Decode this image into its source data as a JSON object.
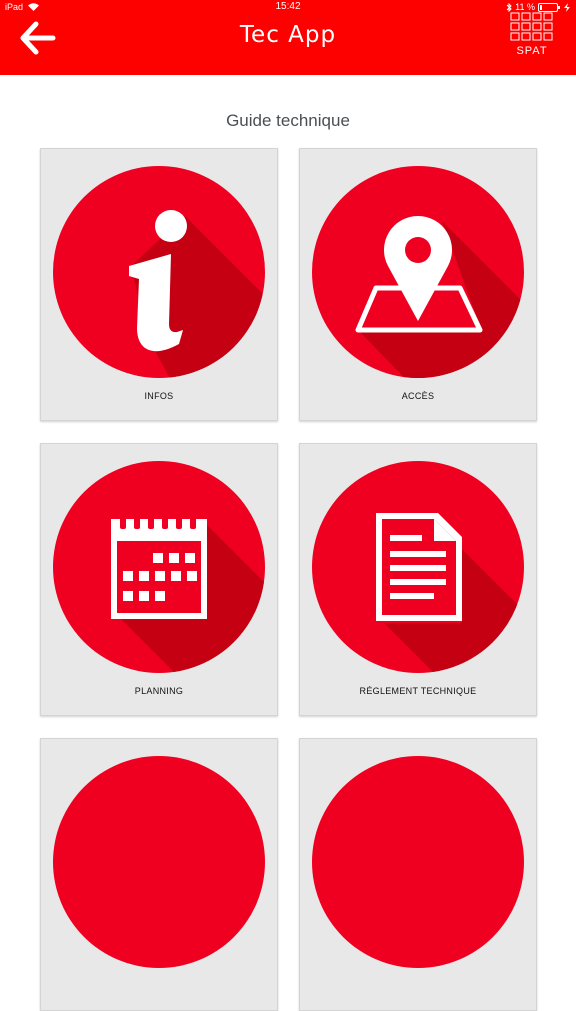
{
  "status_bar": {
    "carrier": "iPad",
    "time": "15:42",
    "battery": "11 %"
  },
  "header": {
    "title": "Tec App",
    "logo_text": "SPAT"
  },
  "section": {
    "title": "Guide technique"
  },
  "tiles": [
    {
      "label": "INFOS",
      "icon": "info-icon"
    },
    {
      "label": "ACCÈS",
      "icon": "map-pin-icon"
    },
    {
      "label": "PLANNING",
      "icon": "calendar-icon"
    },
    {
      "label": "RÉGLEMENT TECHNIQUE",
      "icon": "document-icon"
    }
  ],
  "colors": {
    "brand_red": "#fd0000",
    "circle_red": "#ef0021",
    "shadow_red": "#c50012",
    "card_bg": "#e8e8e8"
  }
}
